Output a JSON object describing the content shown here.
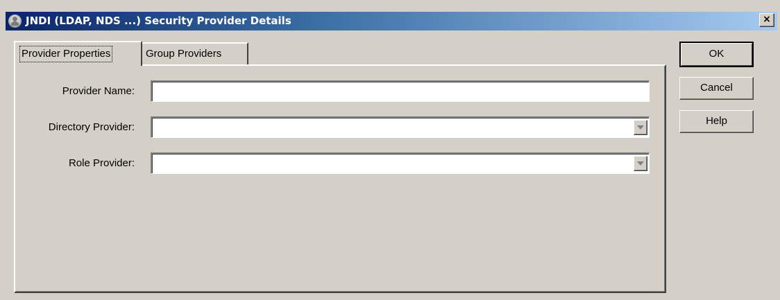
{
  "window": {
    "title": "JNDI (LDAP, NDS ...) Security Provider Details",
    "close_label": "×",
    "title_icon": "user-icon"
  },
  "tabs": [
    {
      "label": "Provider Properties",
      "selected": true
    },
    {
      "label": "Group Providers",
      "selected": false
    }
  ],
  "form": {
    "provider_name": {
      "label": "Provider Name:",
      "value": ""
    },
    "directory_provider": {
      "label": "Directory Provider:",
      "value": ""
    },
    "role_provider": {
      "label": "Role Provider:",
      "value": ""
    }
  },
  "buttons": {
    "ok": "OK",
    "cancel": "Cancel",
    "help": "Help"
  },
  "colors": {
    "titlebar_start": "#0a246a",
    "titlebar_end": "#a6caf0",
    "face": "#d4d0c8"
  }
}
